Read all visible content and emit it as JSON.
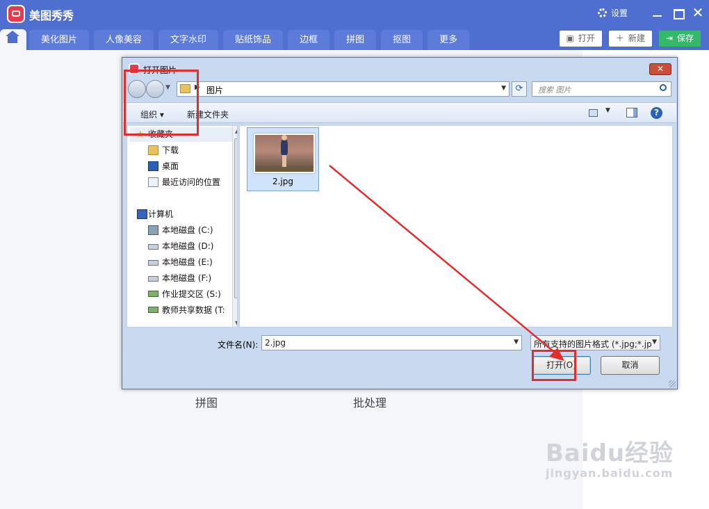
{
  "app": {
    "title": "美图秀秀",
    "settings_label": "设置"
  },
  "tabs": [
    "美化图片",
    "人像美容",
    "文字水印",
    "贴纸饰品",
    "边框",
    "拼图",
    "抠图",
    "更多"
  ],
  "actions": {
    "open_label": "打开",
    "new_label": "新建",
    "save_label": "保存"
  },
  "background": {
    "labels": [
      "拼图",
      "批处理"
    ]
  },
  "watermark": {
    "main": "Baidu经验",
    "sub": "jingyan.baidu.com"
  },
  "dialog": {
    "title": "打开图片",
    "address": "图片",
    "search_placeholder": "搜索 图片",
    "toolbar": {
      "organize": "组织 ▾",
      "new_folder": "新建文件夹"
    },
    "nav": [
      {
        "label": "收藏夹",
        "icon": "star-icon"
      },
      {
        "label": "下载",
        "icon": "download-folder-icon"
      },
      {
        "label": "桌面",
        "icon": "desktop-icon"
      },
      {
        "label": "最近访问的位置",
        "icon": "recent-places-icon"
      },
      {
        "label": "计算机",
        "icon": "computer-icon"
      },
      {
        "label": "本地磁盘 (C:)",
        "icon": "system-drive-icon"
      },
      {
        "label": "本地磁盘 (D:)",
        "icon": "drive-icon"
      },
      {
        "label": "本地磁盘 (E:)",
        "icon": "drive-icon"
      },
      {
        "label": "本地磁盘 (F:)",
        "icon": "drive-icon"
      },
      {
        "label": "作业提交区 (S:)",
        "icon": "network-drive-icon"
      },
      {
        "label": "教师共享数据 (T:",
        "icon": "network-drive-icon"
      }
    ],
    "file": {
      "name": "2.jpg"
    },
    "filename_label": "文件名(N):",
    "filename_value": "2.jpg",
    "filetype_value": "所有支持的图片格式 (*.jpg;*.jp",
    "open_button": "打开(O)",
    "cancel_button": "取消"
  },
  "colors": {
    "brand": "#4f6fd0",
    "save_green": "#34b96a",
    "annotation_red": "#e02d2d",
    "selection": "#cfe4fb"
  }
}
